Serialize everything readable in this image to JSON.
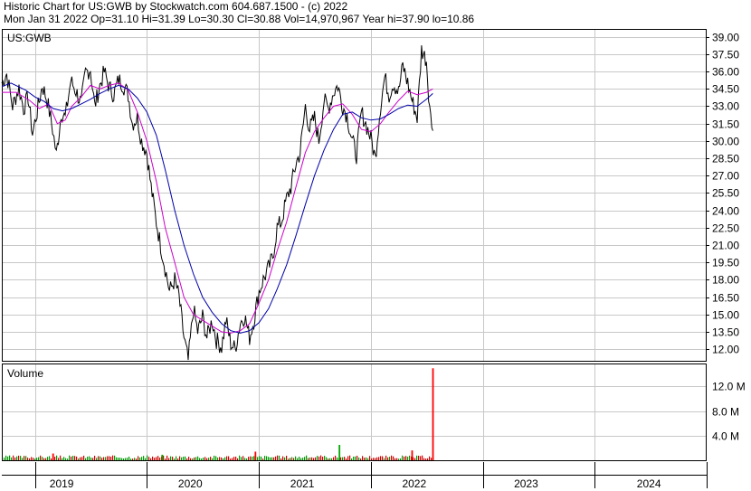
{
  "header": {
    "line1": "Historic Chart for US:GWB by Stockwatch.com 604.687.1500 - (c) 2022",
    "line2": "Mon Jan 31 2022   Op=31.10  Hi=31.39  Lo=30.30  Cl=30.88  Vol=14,970,967  Year hi=37.90  lo=10.86"
  },
  "chart_data": [
    {
      "type": "line",
      "label": "US:GWB",
      "ylim": [
        11.0,
        39.6
      ],
      "y_ticks": [
        "39.00",
        "37.50",
        "36.00",
        "34.50",
        "33.00",
        "31.50",
        "30.00",
        "28.50",
        "27.00",
        "25.50",
        "24.00",
        "22.50",
        "21.00",
        "19.50",
        "18.00",
        "16.50",
        "15.00",
        "13.50",
        "12.00"
      ],
      "grid": true,
      "time_range": [
        "2018-09",
        "2024-12"
      ],
      "series": [
        {
          "key": "price",
          "color": "#000000",
          "points": [
            [
              "2018-09-15",
              35.0
            ],
            [
              "2018-10-01",
              35.8
            ],
            [
              "2018-10-20",
              33.0
            ],
            [
              "2018-11-10",
              34.6
            ],
            [
              "2018-11-25",
              32.8
            ],
            [
              "2018-12-10",
              33.8
            ],
            [
              "2018-12-24",
              30.6
            ],
            [
              "2019-01-08",
              32.5
            ],
            [
              "2019-01-25",
              34.8
            ],
            [
              "2019-02-10",
              33.5
            ],
            [
              "2019-02-28",
              31.0
            ],
            [
              "2019-03-12",
              28.8
            ],
            [
              "2019-03-28",
              32.5
            ],
            [
              "2019-04-10",
              32.0
            ],
            [
              "2019-04-28",
              35.2
            ],
            [
              "2019-05-15",
              34.3
            ],
            [
              "2019-06-01",
              33.2
            ],
            [
              "2019-06-15",
              35.9
            ],
            [
              "2019-07-01",
              36.2
            ],
            [
              "2019-07-15",
              33.0
            ],
            [
              "2019-08-01",
              34.8
            ],
            [
              "2019-08-15",
              36.0
            ],
            [
              "2019-09-01",
              34.6
            ],
            [
              "2019-09-15",
              34.0
            ],
            [
              "2019-10-01",
              35.3
            ],
            [
              "2019-10-15",
              34.9
            ],
            [
              "2019-11-01",
              34.0
            ],
            [
              "2019-11-15",
              31.5
            ],
            [
              "2019-12-01",
              32.0
            ],
            [
              "2019-12-15",
              30.0
            ],
            [
              "2020-01-01",
              29.0
            ],
            [
              "2020-01-15",
              26.0
            ],
            [
              "2020-02-01",
              23.0
            ],
            [
              "2020-02-15",
              21.0
            ],
            [
              "2020-03-01",
              19.0
            ],
            [
              "2020-03-15",
              17.0
            ],
            [
              "2020-04-01",
              18.0
            ],
            [
              "2020-04-15",
              16.5
            ],
            [
              "2020-05-01",
              13.0
            ],
            [
              "2020-05-15",
              11.0
            ],
            [
              "2020-06-01",
              15.5
            ],
            [
              "2020-06-15",
              13.5
            ],
            [
              "2020-07-01",
              14.8
            ],
            [
              "2020-07-15",
              13.0
            ],
            [
              "2020-08-01",
              14.5
            ],
            [
              "2020-08-15",
              12.8
            ],
            [
              "2020-09-01",
              12.2
            ],
            [
              "2020-09-15",
              14.5
            ],
            [
              "2020-10-01",
              12.5
            ],
            [
              "2020-10-15",
              12.0
            ],
            [
              "2020-11-01",
              14.3
            ],
            [
              "2020-11-15",
              14.9
            ],
            [
              "2020-12-01",
              13.0
            ],
            [
              "2020-12-15",
              14.5
            ],
            [
              "2021-01-01",
              17.0
            ],
            [
              "2021-01-15",
              18.0
            ],
            [
              "2021-02-01",
              19.0
            ],
            [
              "2021-02-15",
              20.0
            ],
            [
              "2021-03-01",
              22.5
            ],
            [
              "2021-03-15",
              23.0
            ],
            [
              "2021-04-01",
              25.0
            ],
            [
              "2021-04-15",
              26.0
            ],
            [
              "2021-05-01",
              28.0
            ],
            [
              "2021-05-15",
              29.0
            ],
            [
              "2021-06-01",
              33.0
            ],
            [
              "2021-06-15",
              31.0
            ],
            [
              "2021-07-01",
              32.0
            ],
            [
              "2021-07-15",
              30.0
            ],
            [
              "2021-08-01",
              33.5
            ],
            [
              "2021-08-15",
              32.8
            ],
            [
              "2021-09-01",
              34.2
            ],
            [
              "2021-09-15",
              34.8
            ],
            [
              "2021-10-01",
              33.0
            ],
            [
              "2021-10-15",
              32.2
            ],
            [
              "2021-11-01",
              30.0
            ],
            [
              "2021-11-15",
              28.8
            ],
            [
              "2021-12-01",
              32.5
            ],
            [
              "2021-12-15",
              31.5
            ],
            [
              "2022-01-01",
              30.2
            ],
            [
              "2022-01-15",
              28.5
            ],
            [
              "2022-02-01",
              33.0
            ],
            [
              "2022-02-15",
              35.5
            ],
            [
              "2022-03-01",
              34.0
            ],
            [
              "2022-03-15",
              35.0
            ],
            [
              "2022-04-01",
              34.2
            ],
            [
              "2022-04-15",
              36.5
            ],
            [
              "2022-05-01",
              35.0
            ],
            [
              "2022-05-15",
              33.5
            ],
            [
              "2022-06-01",
              32.0
            ],
            [
              "2022-06-15",
              37.9
            ],
            [
              "2022-07-01",
              37.0
            ],
            [
              "2022-07-08",
              34.2
            ],
            [
              "2022-07-15",
              32.0
            ],
            [
              "2022-07-22",
              30.88
            ]
          ]
        },
        {
          "key": "ma-short",
          "color": "#cc00cc",
          "points": [
            [
              "2018-09-15",
              34.2
            ],
            [
              "2018-11-01",
              34.2
            ],
            [
              "2018-12-15",
              33.5
            ],
            [
              "2019-01-15",
              32.8
            ],
            [
              "2019-02-15",
              33.2
            ],
            [
              "2019-03-15",
              31.5
            ],
            [
              "2019-04-10",
              31.8
            ],
            [
              "2019-05-01",
              33.0
            ],
            [
              "2019-06-01",
              33.8
            ],
            [
              "2019-07-01",
              34.8
            ],
            [
              "2019-08-01",
              34.5
            ],
            [
              "2019-09-01",
              34.8
            ],
            [
              "2019-10-01",
              35.0
            ],
            [
              "2019-11-01",
              34.4
            ],
            [
              "2019-12-01",
              32.5
            ],
            [
              "2020-01-01",
              30.0
            ],
            [
              "2020-02-01",
              26.5
            ],
            [
              "2020-03-01",
              22.5
            ],
            [
              "2020-04-01",
              19.5
            ],
            [
              "2020-05-01",
              16.5
            ],
            [
              "2020-06-01",
              15.0
            ],
            [
              "2020-07-01",
              14.5
            ],
            [
              "2020-08-01",
              14.0
            ],
            [
              "2020-09-01",
              13.5
            ],
            [
              "2020-10-01",
              13.4
            ],
            [
              "2020-11-01",
              13.6
            ],
            [
              "2020-12-01",
              14.2
            ],
            [
              "2021-01-01",
              16.0
            ],
            [
              "2021-02-01",
              18.0
            ],
            [
              "2021-03-01",
              20.5
            ],
            [
              "2021-04-01",
              23.0
            ],
            [
              "2021-05-01",
              26.0
            ],
            [
              "2021-06-01",
              29.0
            ],
            [
              "2021-07-01",
              30.8
            ],
            [
              "2021-08-01",
              32.0
            ],
            [
              "2021-09-01",
              33.0
            ],
            [
              "2021-10-01",
              33.2
            ],
            [
              "2021-11-01",
              32.3
            ],
            [
              "2021-12-01",
              31.0
            ],
            [
              "2022-01-01",
              30.8
            ],
            [
              "2022-02-01",
              31.5
            ],
            [
              "2022-03-01",
              32.5
            ],
            [
              "2022-04-01",
              33.5
            ],
            [
              "2022-05-01",
              34.3
            ],
            [
              "2022-06-01",
              34.0
            ],
            [
              "2022-07-01",
              34.2
            ],
            [
              "2022-07-22",
              34.5
            ]
          ]
        },
        {
          "key": "ma-long",
          "color": "#0000aa",
          "points": [
            [
              "2018-09-15",
              34.7
            ],
            [
              "2018-10-15",
              35.0
            ],
            [
              "2018-12-01",
              34.4
            ],
            [
              "2019-01-01",
              33.8
            ],
            [
              "2019-02-01",
              33.4
            ],
            [
              "2019-03-01",
              32.8
            ],
            [
              "2019-04-01",
              32.6
            ],
            [
              "2019-05-01",
              32.8
            ],
            [
              "2019-06-01",
              33.2
            ],
            [
              "2019-07-01",
              33.6
            ],
            [
              "2019-08-01",
              34.1
            ],
            [
              "2019-09-01",
              34.5
            ],
            [
              "2019-10-01",
              34.8
            ],
            [
              "2019-11-01",
              34.5
            ],
            [
              "2019-12-01",
              33.7
            ],
            [
              "2020-01-01",
              32.5
            ],
            [
              "2020-02-01",
              30.5
            ],
            [
              "2020-03-01",
              27.5
            ],
            [
              "2020-04-01",
              24.0
            ],
            [
              "2020-05-01",
              21.0
            ],
            [
              "2020-06-01",
              18.5
            ],
            [
              "2020-07-01",
              16.5
            ],
            [
              "2020-08-01",
              15.2
            ],
            [
              "2020-09-01",
              14.2
            ],
            [
              "2020-10-01",
              13.6
            ],
            [
              "2020-11-01",
              13.4
            ],
            [
              "2020-12-01",
              13.6
            ],
            [
              "2021-01-01",
              14.3
            ],
            [
              "2021-02-01",
              15.5
            ],
            [
              "2021-03-01",
              17.2
            ],
            [
              "2021-04-01",
              19.3
            ],
            [
              "2021-05-01",
              21.8
            ],
            [
              "2021-06-01",
              24.5
            ],
            [
              "2021-07-01",
              27.0
            ],
            [
              "2021-08-01",
              29.2
            ],
            [
              "2021-09-01",
              31.0
            ],
            [
              "2021-10-01",
              32.3
            ],
            [
              "2021-11-01",
              32.5
            ],
            [
              "2021-12-01",
              32.0
            ],
            [
              "2022-01-01",
              31.8
            ],
            [
              "2022-02-01",
              31.9
            ],
            [
              "2022-03-01",
              32.3
            ],
            [
              "2022-04-01",
              32.8
            ],
            [
              "2022-05-01",
              33.1
            ],
            [
              "2022-06-01",
              33.0
            ],
            [
              "2022-07-01",
              33.6
            ],
            [
              "2022-07-22",
              34.1
            ]
          ]
        }
      ]
    },
    {
      "type": "bar",
      "label": "Volume",
      "y_ticks": [
        "12.0 M",
        "8.0 M",
        "4.0 M"
      ],
      "ylim": [
        0,
        15.6
      ],
      "grid": true,
      "spikes": [
        {
          "x": "2022-07-22",
          "value": 14.97,
          "color": "#ff0000"
        },
        {
          "x": "2022-05-15",
          "value": 1.6,
          "color": "#ff0000"
        },
        {
          "x": "2021-09-20",
          "value": 2.5,
          "color": "#00aa00"
        },
        {
          "x": "2020-12-20",
          "value": 1.4,
          "color": "#ff0000"
        },
        {
          "x": "2019-03-01",
          "value": 1.1,
          "color": "#ff0000"
        },
        {
          "x": "2020-02-20",
          "value": 0.9,
          "color": "#00aa00"
        }
      ]
    }
  ],
  "x_axis": {
    "year_labels": [
      "2019",
      "2020",
      "2021",
      "2022",
      "2023",
      "2024"
    ]
  }
}
